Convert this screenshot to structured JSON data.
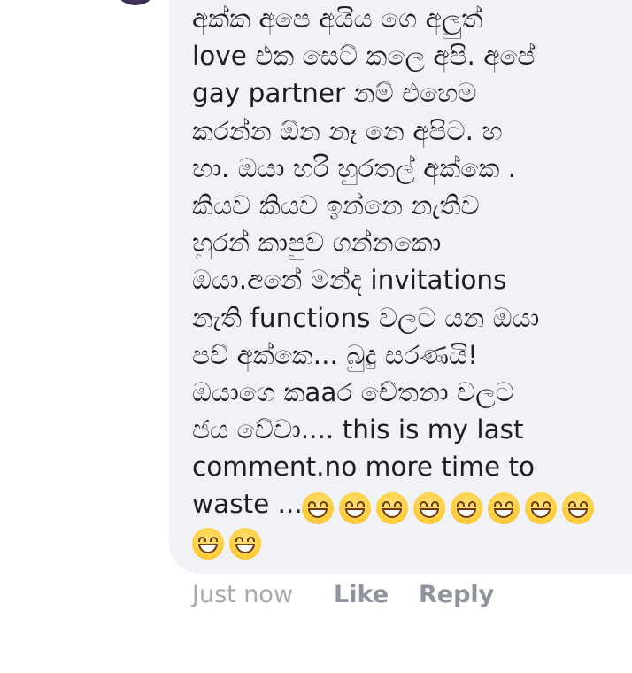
{
  "comment": {
    "lines": [
      "අක්ක අපෙ අයිය ගෙ අලුත්",
      "love එක සෙට් කලෙ අපි. අපේ",
      "gay partner නම් එහෙම",
      "කරන්න ඕන නෑ නෙ අපිට. හ",
      "හා. ඔයා හරි හුරතල් අක්කෙ .",
      "කියව කියව ඉන්නෙ නැතිව",
      "හුරන් කාපුව ගන්නකො",
      "ඔයා.අනේ මන්ද invitations",
      "නැති functions වලට යන ඔයා",
      "පව් අක්කෙ... බුදු සරණයි!",
      "ඔයාගෙ කaaර චේතනා වලට",
      "ජය වේවා.... this is my last",
      "comment.no more  time to",
      "waste ..."
    ],
    "emoji": "grinning-face-with-smiling-eyes",
    "emoji_count_line1": 8,
    "emoji_count_line2": 2
  },
  "meta": {
    "time": "Just now",
    "like_label": "Like",
    "reply_label": "Reply"
  }
}
